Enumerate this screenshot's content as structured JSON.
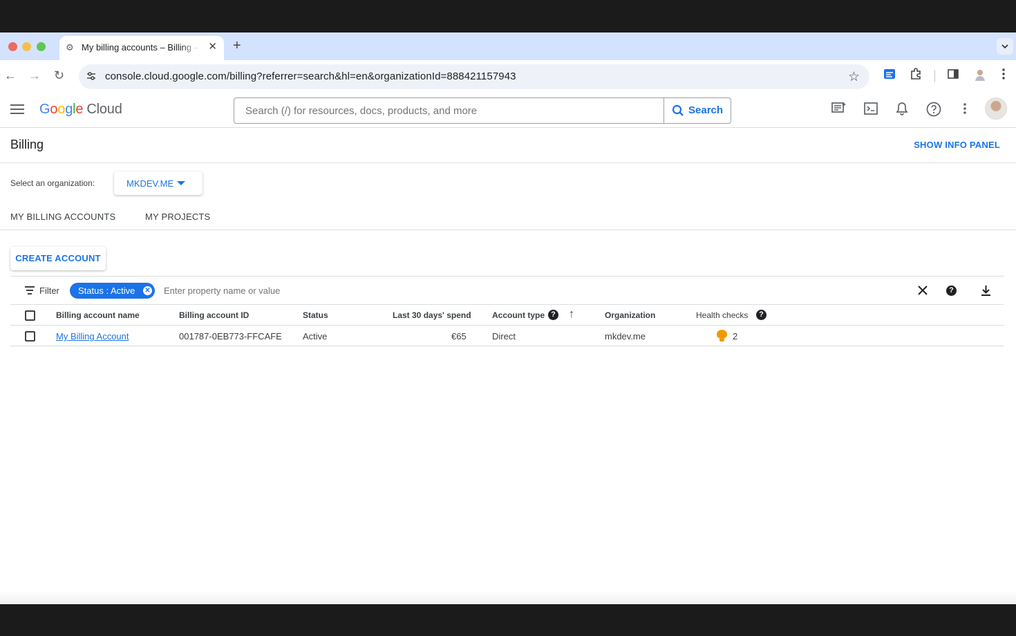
{
  "browser": {
    "tab_title": "My billing accounts – Billing – Google Cloud console",
    "new_tab_label": "+",
    "url": "console.cloud.google.com/billing?referrer=search&hl=en&organizationId=888421157943"
  },
  "header": {
    "logo_google": [
      "G",
      "o",
      "o",
      "g",
      "l",
      "e"
    ],
    "logo_cloud": "Cloud",
    "search_placeholder": "Search (/) for resources, docs, products, and more",
    "search_button": "Search"
  },
  "page": {
    "title": "Billing",
    "info_panel_button": "SHOW INFO PANEL",
    "org_label": "Select an organization:",
    "org_value": "MKDEV.ME",
    "tabs": [
      "MY BILLING ACCOUNTS",
      "MY PROJECTS"
    ],
    "create_button": "CREATE ACCOUNT"
  },
  "filter": {
    "label": "Filter",
    "chip": "Status : Active",
    "placeholder": "Enter property name or value"
  },
  "table": {
    "headers": [
      "Billing account name",
      "Billing account ID",
      "Status",
      "Last 30 days' spend",
      "Account type",
      "Organization",
      "Health checks"
    ],
    "rows": [
      {
        "name": "My Billing Account",
        "id": "001787-0EB773-FFCAFE",
        "status": "Active",
        "spend": "€65",
        "type": "Direct",
        "org": "mkdev.me",
        "health": "2"
      }
    ]
  },
  "icons": {
    "tab_favicon": "⚙",
    "close": "✕",
    "back": "←",
    "forward": "→",
    "reload": "↻",
    "star": "☆",
    "chevron_down": "⌄",
    "sort_up": "↑",
    "download": "⤓",
    "help": "?"
  },
  "colors": {
    "accent": "#1a73e8",
    "warning": "#f29900"
  }
}
